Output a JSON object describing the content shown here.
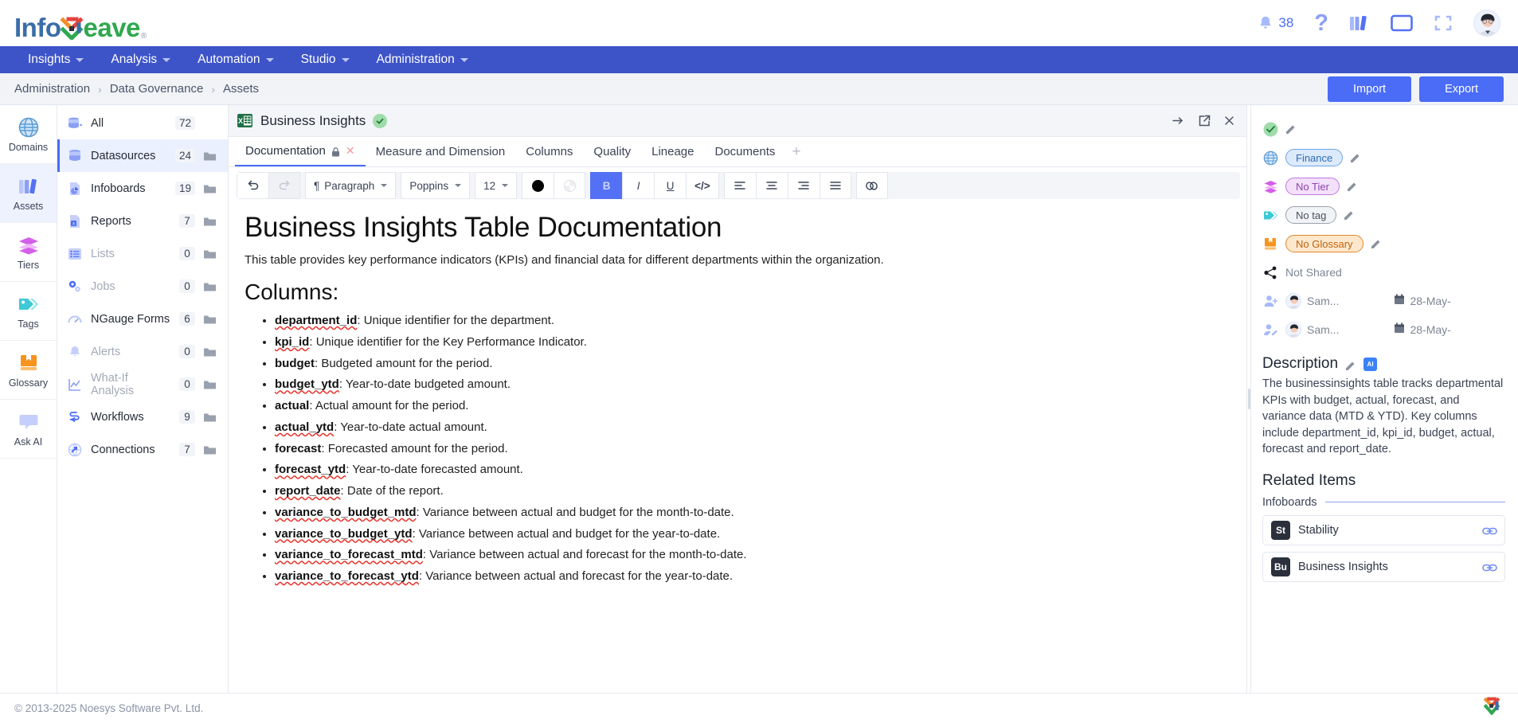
{
  "app": {
    "logo_info": "Info",
    "logo_eave": "eave",
    "logo_reg": "®"
  },
  "topbar": {
    "notification_count": "38",
    "icons": [
      "bell-icon",
      "help-icon",
      "library-icon",
      "monitor-icon",
      "fullscreen-icon",
      "avatar"
    ]
  },
  "nav": {
    "items": [
      {
        "label": "Insights"
      },
      {
        "label": "Analysis"
      },
      {
        "label": "Automation"
      },
      {
        "label": "Studio"
      },
      {
        "label": "Administration"
      }
    ]
  },
  "breadcrumb": {
    "items": [
      "Administration",
      "Data Governance",
      "Assets"
    ],
    "separator": "›",
    "import_label": "Import",
    "export_label": "Export"
  },
  "rail": {
    "items": [
      {
        "label": "Domains",
        "icon": "globe-icon",
        "active": false
      },
      {
        "label": "Assets",
        "icon": "library-icon",
        "active": true
      },
      {
        "label": "Tiers",
        "icon": "layers-icon",
        "active": false
      },
      {
        "label": "Tags",
        "icon": "tag-icon",
        "active": false
      },
      {
        "label": "Glossary",
        "icon": "book-icon",
        "active": false
      },
      {
        "label": "Ask AI",
        "icon": "chat-icon",
        "active": false
      }
    ]
  },
  "asset_list": {
    "items": [
      {
        "label": "All",
        "count": "72",
        "icon": "database-all-icon",
        "active": false,
        "dim": false,
        "folder": false
      },
      {
        "label": "Datasources",
        "count": "24",
        "icon": "database-icon",
        "active": true,
        "dim": false,
        "folder": true
      },
      {
        "label": "Infoboards",
        "count": "19",
        "icon": "infoboard-icon",
        "active": false,
        "dim": false,
        "folder": true
      },
      {
        "label": "Reports",
        "count": "7",
        "icon": "report-icon",
        "active": false,
        "dim": false,
        "folder": true
      },
      {
        "label": "Lists",
        "count": "0",
        "icon": "list-icon",
        "active": false,
        "dim": true,
        "folder": true
      },
      {
        "label": "Jobs",
        "count": "0",
        "icon": "jobs-icon",
        "active": false,
        "dim": true,
        "folder": true
      },
      {
        "label": "NGauge Forms",
        "count": "6",
        "icon": "ngauge-icon",
        "active": false,
        "dim": false,
        "folder": true
      },
      {
        "label": "Alerts",
        "count": "0",
        "icon": "alert-bell-icon",
        "active": false,
        "dim": true,
        "folder": true
      },
      {
        "label": "What-If Analysis",
        "count": "0",
        "icon": "whatif-icon",
        "active": false,
        "dim": true,
        "folder": true
      },
      {
        "label": "Workflows",
        "count": "9",
        "icon": "workflow-icon",
        "active": false,
        "dim": false,
        "folder": true
      },
      {
        "label": "Connections",
        "count": "7",
        "icon": "connections-icon",
        "active": false,
        "dim": false,
        "folder": true
      }
    ]
  },
  "asset": {
    "title": "Business Insights",
    "verified": true,
    "tabs": [
      {
        "label": "Documentation",
        "active": true,
        "lock": true,
        "closable": true
      },
      {
        "label": "Measure and Dimension",
        "active": false
      },
      {
        "label": "Columns",
        "active": false
      },
      {
        "label": "Quality",
        "active": false
      },
      {
        "label": "Lineage",
        "active": false
      },
      {
        "label": "Documents",
        "active": false
      }
    ],
    "add_tab": "+"
  },
  "editor_toolbar": {
    "undo": "undo-icon",
    "redo": "redo-icon",
    "block_style": "Paragraph",
    "font_family": "Poppins",
    "font_size": "12",
    "text_color": "#000000",
    "highlight": "none",
    "bold": "B",
    "italic": "I",
    "underline": "U",
    "code": "</>",
    "align_left": "align-left-icon",
    "align_center": "align-center-icon",
    "align_right": "align-right-icon",
    "align_justify": "align-justify-icon",
    "link": "link-icon"
  },
  "document": {
    "h1": "Business Insights Table Documentation",
    "intro": "This table provides key performance indicators (KPIs) and financial data for different departments within the organization.",
    "h2": "Columns:",
    "columns": [
      {
        "name": "department_id",
        "desc": ": Unique identifier for the department.",
        "spell": true
      },
      {
        "name": "kpi_id",
        "desc": ": Unique identifier for the Key Performance Indicator.",
        "spell": true
      },
      {
        "name": "budget",
        "desc": ": Budgeted amount for the period.",
        "spell": false
      },
      {
        "name": "budget_ytd",
        "desc": ": Year-to-date budgeted amount.",
        "spell": true
      },
      {
        "name": "actual",
        "desc": ": Actual amount for the period.",
        "spell": false
      },
      {
        "name": "actual_ytd",
        "desc": ": Year-to-date actual amount.",
        "spell": true
      },
      {
        "name": "forecast",
        "desc": ": Forecasted amount for the period.",
        "spell": false
      },
      {
        "name": "forecast_ytd",
        "desc": ": Year-to-date forecasted amount.",
        "spell": true
      },
      {
        "name": "report_date",
        "desc": ": Date of the report.",
        "spell": true
      },
      {
        "name": "variance_to_budget_mtd",
        "desc": ": Variance between actual and budget for the month-to-date.",
        "spell": true
      },
      {
        "name": "variance_to_budget_ytd",
        "desc": ": Variance between actual and budget for the year-to-date.",
        "spell": true
      },
      {
        "name": "variance_to_forecast_mtd",
        "desc": ": Variance between actual and forecast for the month-to-date.",
        "spell": true
      },
      {
        "name": "variance_to_forecast_ytd",
        "desc": ": Variance between actual and forecast for the year-to-date.",
        "spell": true
      }
    ]
  },
  "details": {
    "domain": "Finance",
    "tier": "No Tier",
    "tag": "No tag",
    "glossary": "No Glossary",
    "shared": "Not Shared",
    "created_by": "Sam...",
    "created_date": "28-May-",
    "updated_by": "Sam...",
    "updated_date": "28-May-",
    "description_title": "Description",
    "description": "The businessinsights table tracks departmental KPIs with budget, actual, forecast, and variance data (MTD & YTD). Key columns include department_id, kpi_id, budget, actual, forecast and report_date.",
    "related_title": "Related Items",
    "related_group": "Infoboards",
    "related": [
      {
        "initials": "St",
        "name": "Stability"
      },
      {
        "initials": "Bu",
        "name": "Business Insights"
      }
    ]
  },
  "footer": {
    "copyright": "© 2013-2025 Noesys Software Pvt. Ltd."
  },
  "colors": {
    "brand_blue": "#3d53c8",
    "accent": "#4a6cf7",
    "green": "#2fa84f"
  }
}
